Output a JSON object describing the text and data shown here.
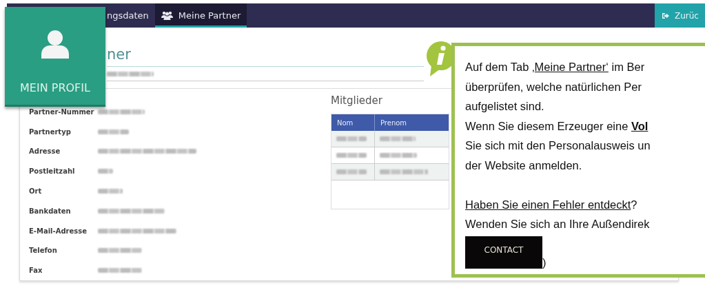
{
  "navbar": {
    "tabs": [
      {
        "label": "ngsdaten",
        "selected": false
      },
      {
        "label": "Meine Partner",
        "selected": true
      }
    ],
    "back_button": {
      "label": "Zurüc"
    }
  },
  "profile_card": {
    "label": "MEIN PROFIL"
  },
  "page": {
    "title": "ner",
    "subtitle": {
      "kind": "blurred"
    }
  },
  "details": [
    {
      "label": "Partner-Nummer",
      "kind": "blurred"
    },
    {
      "label": "Partnertyp",
      "kind": "blurred"
    },
    {
      "label": "Adresse",
      "kind": "blurred"
    },
    {
      "label": "Postleitzahl",
      "kind": "blurred"
    },
    {
      "label": "Ort",
      "kind": "blurred"
    },
    {
      "label": "Bankdaten",
      "kind": "blurred"
    },
    {
      "label": "E-Mail-Adresse",
      "kind": "blurred"
    },
    {
      "label": "Telefon",
      "kind": "blurred"
    },
    {
      "label": "Fax",
      "kind": "blurred"
    }
  ],
  "members": {
    "title": "Mitglieder",
    "columns": [
      "Nom",
      "Prenom"
    ],
    "rows": [
      {
        "kind": "blurred"
      },
      {
        "kind": "blurred"
      },
      {
        "kind": "blurred"
      }
    ]
  },
  "callout": {
    "lines": [
      {
        "parts": [
          {
            "text": "Auf dem Tab ",
            "kind": "plain"
          },
          {
            "text": "‚Meine Partner‘",
            "kind": "link"
          },
          {
            "text": " im Ber",
            "kind": "plain"
          }
        ]
      },
      {
        "parts": [
          {
            "text": "überprüfen, welche natürlichen Per",
            "kind": "plain"
          }
        ]
      },
      {
        "parts": [
          {
            "text": "aufgelistet sind.",
            "kind": "plain"
          }
        ]
      },
      {
        "parts": [
          {
            "text": "Wenn Sie diesem Erzeuger eine ",
            "kind": "plain"
          },
          {
            "text": "Vol",
            "kind": "strong-link"
          }
        ]
      },
      {
        "parts": [
          {
            "text": "Sie sich mit den Personalausweis un",
            "kind": "plain"
          }
        ]
      },
      {
        "parts": [
          {
            "text": "der Website anmelden.",
            "kind": "plain"
          }
        ]
      },
      {
        "parts": [
          {
            "text": "Haben Sie einen Fehler entdeckt",
            "kind": "link"
          },
          {
            "text": "?",
            "kind": "plain"
          }
        ],
        "spaced": true
      },
      {
        "parts": [
          {
            "text": "Wenden Sie sich an Ihre Außendirek",
            "kind": "plain"
          }
        ]
      }
    ],
    "button": {
      "label": "CONTACT"
    },
    "after_button": ")"
  }
}
